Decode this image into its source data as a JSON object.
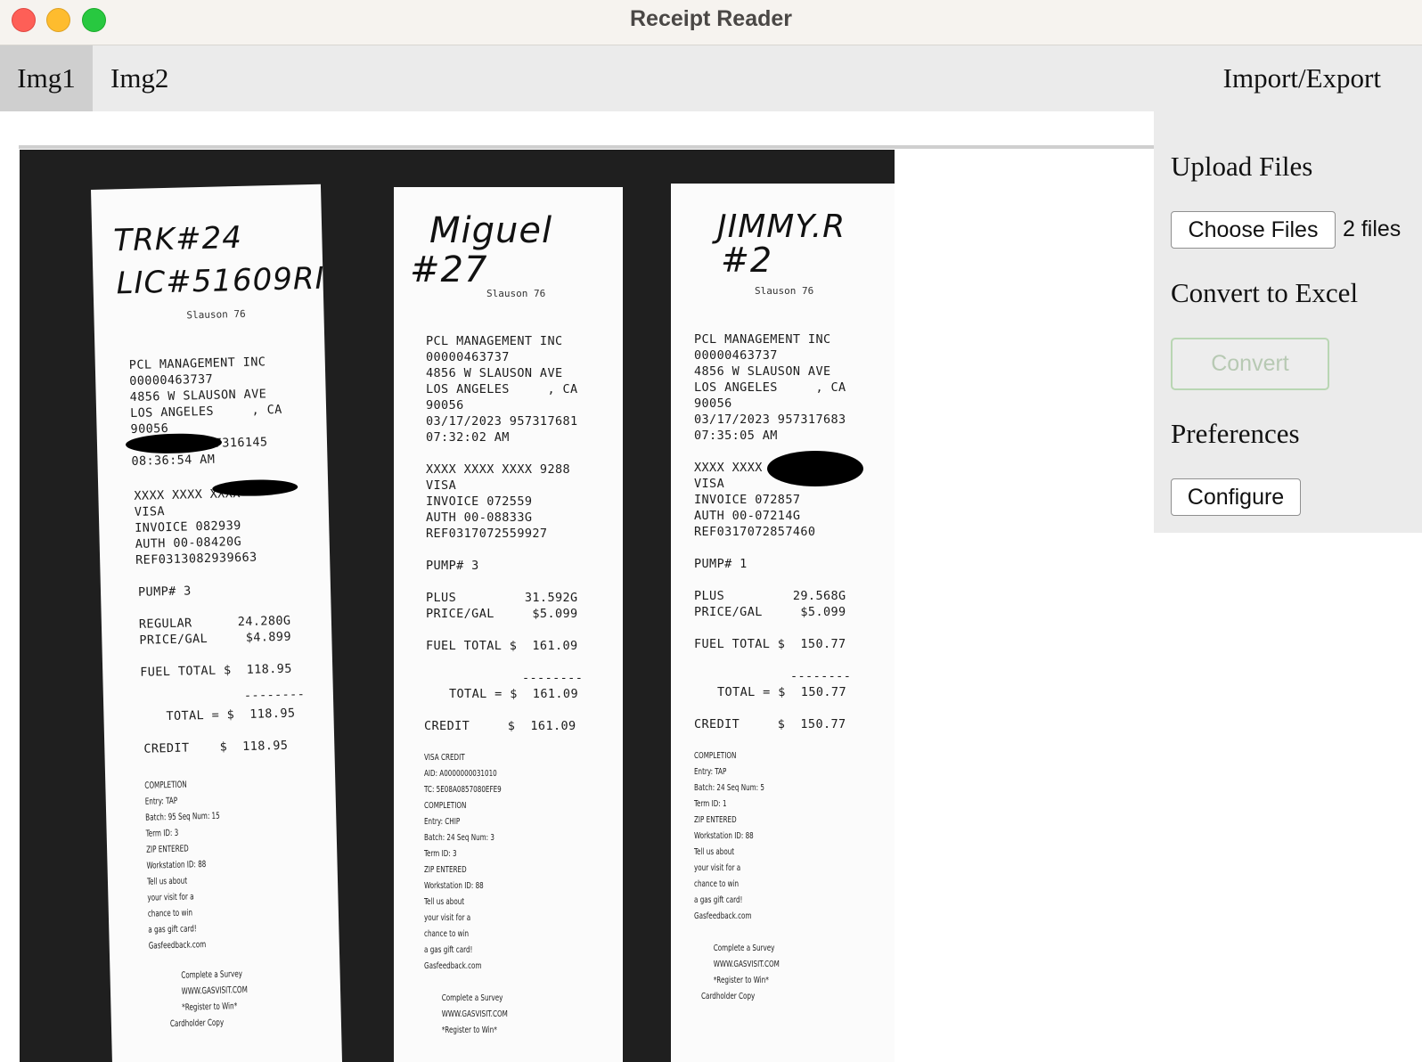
{
  "window": {
    "title": "Receipt Reader"
  },
  "tabs": {
    "img1": "Img1",
    "img2": "Img2",
    "import_export": "Import/Export"
  },
  "panel": {
    "upload_heading": "Upload Files",
    "choose_files_label": "Choose Files",
    "files_status": "2 files",
    "convert_heading": "Convert to Excel",
    "convert_label": "Convert",
    "preferences_heading": "Preferences",
    "configure_label": "Configure"
  },
  "colors": {
    "titlebar": "#f6f3ef",
    "tabbar": "#ebebeb",
    "tab_active": "#cfcfcf",
    "convert_border": "#b9d6b3"
  },
  "receipts": [
    {
      "handwriting_1": "TRK#24",
      "handwriting_2": "LIC#51609RI",
      "brand": "Slauson 76",
      "header": "PCL MANAGEMENT INC\n00000463737\n4856 W SLAUSON AVE\nLOS ANGELES     , CA\n90056",
      "datetime": "         957316145\n08:36:54 AM",
      "card": "XXXX XXXX XXXX\nVISA\nINVOICE 082939\nAUTH 00-08420G\nREF0313082939663",
      "pump": "PUMP# 3",
      "fuel": "REGULAR      24.280G\nPRICE/GAL     $4.899",
      "fuel_total": "FUEL TOTAL $  118.95",
      "dashes": "--------",
      "total": "TOTAL = $  118.95",
      "credit": "CREDIT    $  118.95",
      "details": "COMPLETION\nEntry: TAP\nBatch: 95 Seq Num: 15\nTerm ID: 3\nZIP ENTERED\nWorkstation ID: 88\nTell us about\nyour visit for a\nchance to win\na gas gift card!\nGasfeedback.com",
      "footer": "      Complete a Survey\n      WWW.GASVISIT.COM\n      *Register to Win*\nCardholder Copy"
    },
    {
      "handwriting_1": "Miguel",
      "handwriting_2": "#27",
      "brand": "Slauson 76",
      "header": "PCL MANAGEMENT INC\n00000463737\n4856 W SLAUSON AVE\nLOS ANGELES     , CA\n90056\n03/17/2023 957317681\n07:32:02 AM",
      "card": "XXXX XXXX XXXX 9288\nVISA\nINVOICE 072559\nAUTH 00-08833G\nREF0317072559927",
      "pump": "PUMP# 3",
      "fuel": "PLUS         31.592G\nPRICE/GAL     $5.099",
      "fuel_total": "FUEL TOTAL $  161.09",
      "dashes": "--------",
      "total": "TOTAL = $  161.09",
      "credit": "CREDIT     $  161.09",
      "details": "VISA CREDIT\nAID: A0000000031010\nTC: 5E08A0857080EFE9\nCOMPLETION\nEntry: CHIP\nBatch: 24 Seq Num: 3\nTerm ID: 3\nZIP ENTERED\nWorkstation ID: 88\nTell us about\nyour visit for a\nchance to win\na gas gift card!\nGasfeedback.com",
      "footer": "      Complete a Survey\n      WWW.GASVISIT.COM\n      *Register to Win*"
    },
    {
      "handwriting_1": "JIMMY.R",
      "handwriting_2": "#2",
      "brand": "Slauson 76",
      "header": "PCL MANAGEMENT INC\n00000463737\n4856 W SLAUSON AVE\nLOS ANGELES     , CA\n90056\n03/17/2023 957317683\n07:35:05 AM",
      "card": "XXXX XXXX\nVISA\nINVOICE 072857\nAUTH 00-07214G\nREF0317072857460",
      "pump": "PUMP# 1",
      "fuel": "PLUS         29.568G\nPRICE/GAL     $5.099",
      "fuel_total": "FUEL TOTAL $  150.77",
      "dashes": "--------",
      "total": "TOTAL = $  150.77",
      "credit": "CREDIT     $  150.77",
      "details": "COMPLETION\nEntry: TAP\nBatch: 24 Seq Num: 5\nTerm ID: 1\nZIP ENTERED\nWorkstation ID: 88\nTell us about\nyour visit for a\nchance to win\na gas gift card!\nGasfeedback.com",
      "footer": "      Complete a Survey\n      WWW.GASVISIT.COM\n      *Register to Win*\nCardholder Copy"
    }
  ]
}
